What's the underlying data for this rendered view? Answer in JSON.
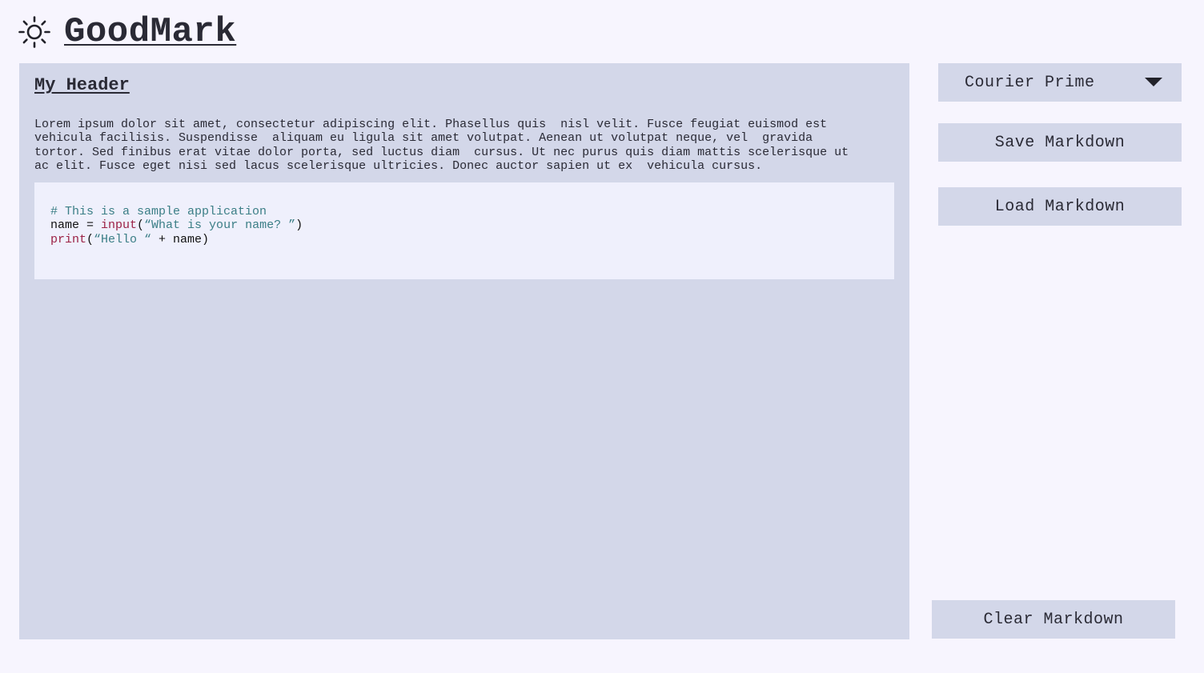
{
  "app": {
    "title": "GoodMark",
    "theme_icon": "sun-icon"
  },
  "document": {
    "heading": "My Header",
    "paragraph": "Lorem ipsum dolor sit amet, consectetur adipiscing elit. Phasellus quis  nisl velit. Fusce feugiat euismod est\nvehicula facilisis. Suspendisse  aliquam eu ligula sit amet volutpat. Aenean ut volutpat neque, vel  gravida\ntortor. Sed finibus erat vitae dolor porta, sed luctus diam  cursus. Ut nec purus quis diam mattis scelerisque ut\nac elit. Fusce eget nisi sed lacus scelerisque ultricies. Donec auctor sapien ut ex  vehicula cursus.",
    "code": {
      "comment": "# This is a sample application",
      "line2_var": "name = ",
      "line2_fn": "input",
      "line2_open": "(",
      "line2_str": "“What is your name? ”",
      "line2_close": ")",
      "line3_fn": "print",
      "line3_open": "(",
      "line3_str": "“Hello “",
      "line3_rest": " + name)"
    }
  },
  "sidebar": {
    "font_select": {
      "selected": "Courier Prime",
      "icon": "chevron-down-icon"
    },
    "save_label": "Save Markdown",
    "load_label": "Load Markdown",
    "clear_label": "Clear Markdown"
  },
  "colors": {
    "background": "#f7f5fe",
    "panel": "#d3d7e9",
    "code_background": "#eff0fc",
    "code_string": "#3b7e86",
    "code_function": "#9b2145"
  }
}
